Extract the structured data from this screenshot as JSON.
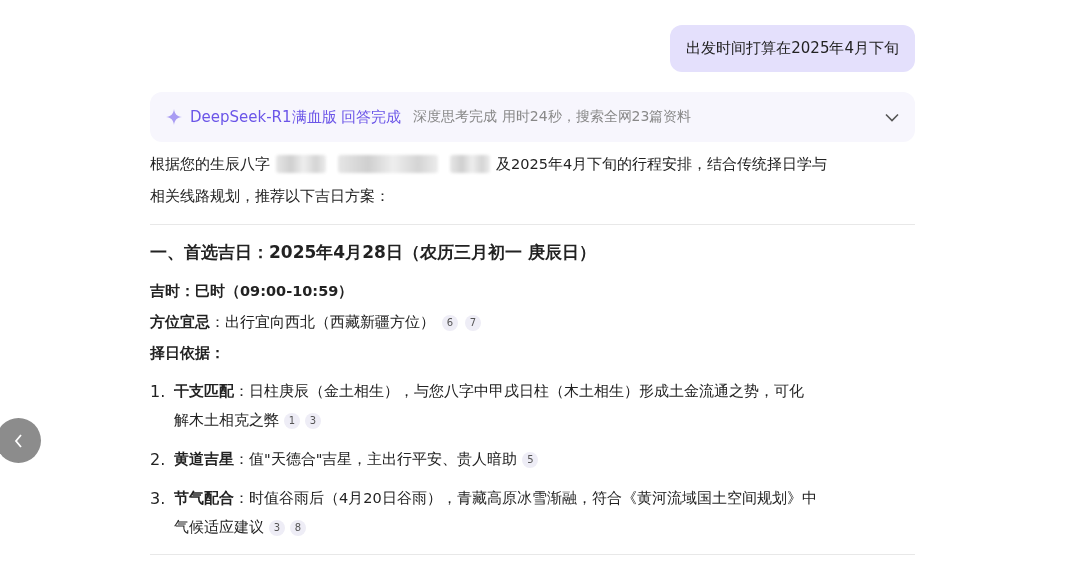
{
  "user_message": "出发时间打算在2025年4月下旬",
  "status": {
    "model": "DeepSeek-R1满血版 回答完成",
    "detail": "深度思考完成 用时24秒，搜索全网23篇资料",
    "expanded": false
  },
  "intro": {
    "before": "根据您的生辰八字",
    "after": [
      "及2025年4月下旬的行程安排，结合传统择日学与",
      "相关线路规划，推荐以下吉日方案："
    ]
  },
  "heading": "一、首选吉日：2025年4月28日（农历三月初一 庚辰日）",
  "lines": [
    {
      "text": "吉时：巳时（09:00-10:59）",
      "kind": "bold"
    },
    {
      "text": "**方位宜忌**：出行宜向西北（西藏新疆方位）",
      "kind": "mixed",
      "citations": [
        "6",
        "7"
      ]
    },
    {
      "text": "择日依据：",
      "kind": "bold"
    }
  ],
  "points": [
    {
      "number": "1.",
      "lines": [
        "**干支匹配**：日柱庚辰（金土相生），与您八字中甲戌日柱（木土相生）形成土金流通之势，可化",
        "解木土相克之弊"
      ],
      "citations": [
        "1",
        "3"
      ]
    },
    {
      "number": "2.",
      "lines": [
        "**黄道吉星**：值\"天德合\"吉星，主出行平安、贵人暗助"
      ],
      "citations": [
        "5"
      ]
    },
    {
      "number": "3.",
      "lines": [
        "**节气配合**：时值谷雨后（4月20日谷雨），青藏高原冰雪渐融，符合《黄河流域国土空间规划》中",
        "气候适应建议"
      ],
      "citations": [
        "3",
        "8"
      ]
    }
  ]
}
